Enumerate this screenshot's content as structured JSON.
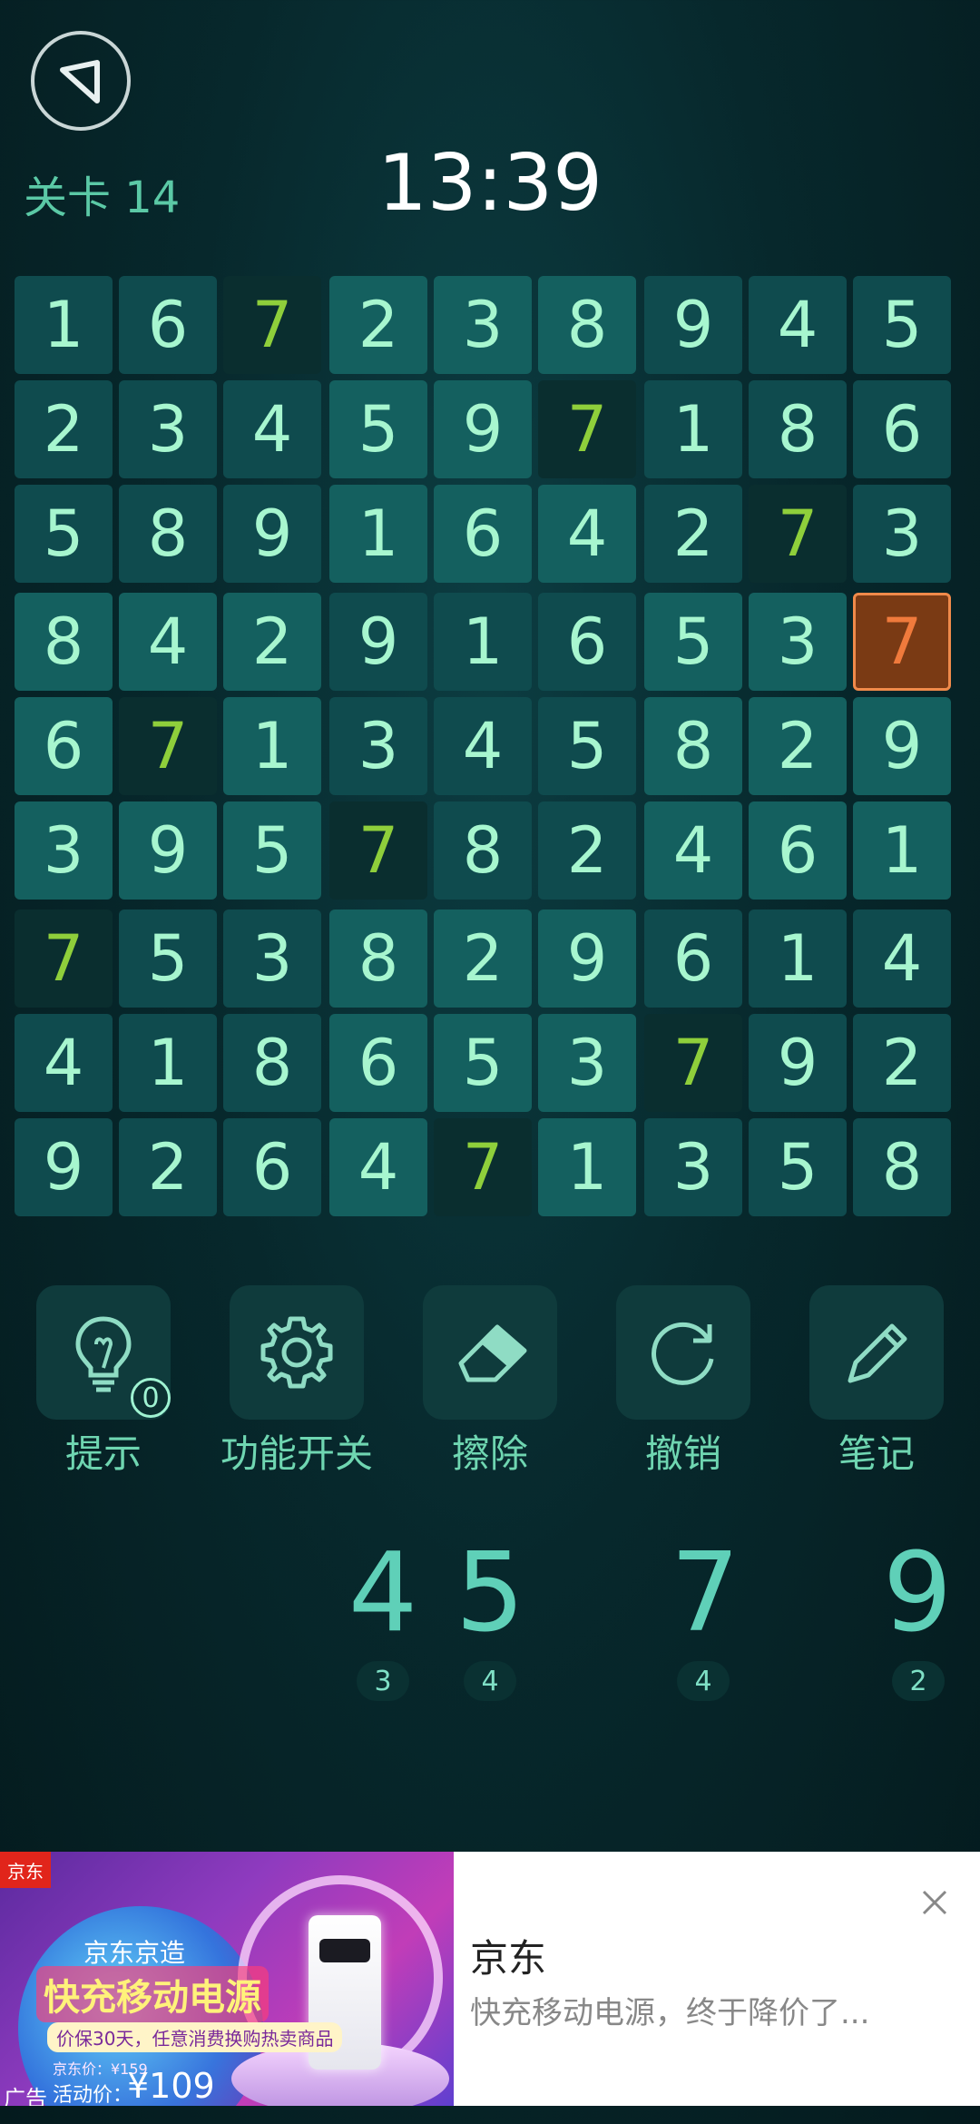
{
  "header": {
    "level_label": "关卡 14",
    "timer": "13:39"
  },
  "board": {
    "grid": [
      [
        1,
        6,
        7,
        2,
        3,
        8,
        9,
        4,
        5
      ],
      [
        2,
        3,
        4,
        5,
        9,
        7,
        1,
        8,
        6
      ],
      [
        5,
        8,
        9,
        1,
        6,
        4,
        2,
        7,
        3
      ],
      [
        8,
        4,
        2,
        9,
        1,
        6,
        5,
        3,
        7
      ],
      [
        6,
        7,
        1,
        3,
        4,
        5,
        8,
        2,
        9
      ],
      [
        3,
        9,
        5,
        7,
        8,
        2,
        4,
        6,
        1
      ],
      [
        7,
        5,
        3,
        8,
        2,
        9,
        6,
        1,
        4
      ],
      [
        4,
        1,
        8,
        6,
        5,
        3,
        7,
        9,
        2
      ],
      [
        9,
        2,
        6,
        4,
        7,
        1,
        3,
        5,
        8
      ]
    ],
    "selected_digit": 7,
    "selected_cell": {
      "row": 4,
      "col": 9
    }
  },
  "tools": [
    {
      "label": "提示",
      "icon": "lightbulb-icon",
      "badge": "0"
    },
    {
      "label": "功能开关",
      "icon": "gear-icon"
    },
    {
      "label": "擦除",
      "icon": "eraser-icon"
    },
    {
      "label": "撤销",
      "icon": "undo-icon"
    },
    {
      "label": "笔记",
      "icon": "pencil-icon"
    }
  ],
  "number_pad": [
    {
      "digit": "4",
      "remaining": "3"
    },
    {
      "digit": "5",
      "remaining": "4"
    },
    {
      "digit": "7",
      "remaining": "4"
    },
    {
      "digit": "9",
      "remaining": "2"
    }
  ],
  "ad": {
    "brand_tag": "京东",
    "image_line1": "京东京造",
    "image_line2": "快充移动电源",
    "image_line3": "价保30天，任意消费换购热卖商品",
    "image_line4": "京东价：¥159",
    "image_line5": "活动价：",
    "image_price": "¥109",
    "ad_mark": "广告",
    "name": "京东",
    "description": "快充移动电源，终于降价了..."
  },
  "colors": {
    "background": "#06262a",
    "cell_light": "#14605f",
    "cell_mid": "#0f4b4e",
    "cell_highlight": "#0a2e2f",
    "highlight_digit": "#8fcf3b",
    "selected": "#7a3a14",
    "digit": "#a7f6cf"
  }
}
